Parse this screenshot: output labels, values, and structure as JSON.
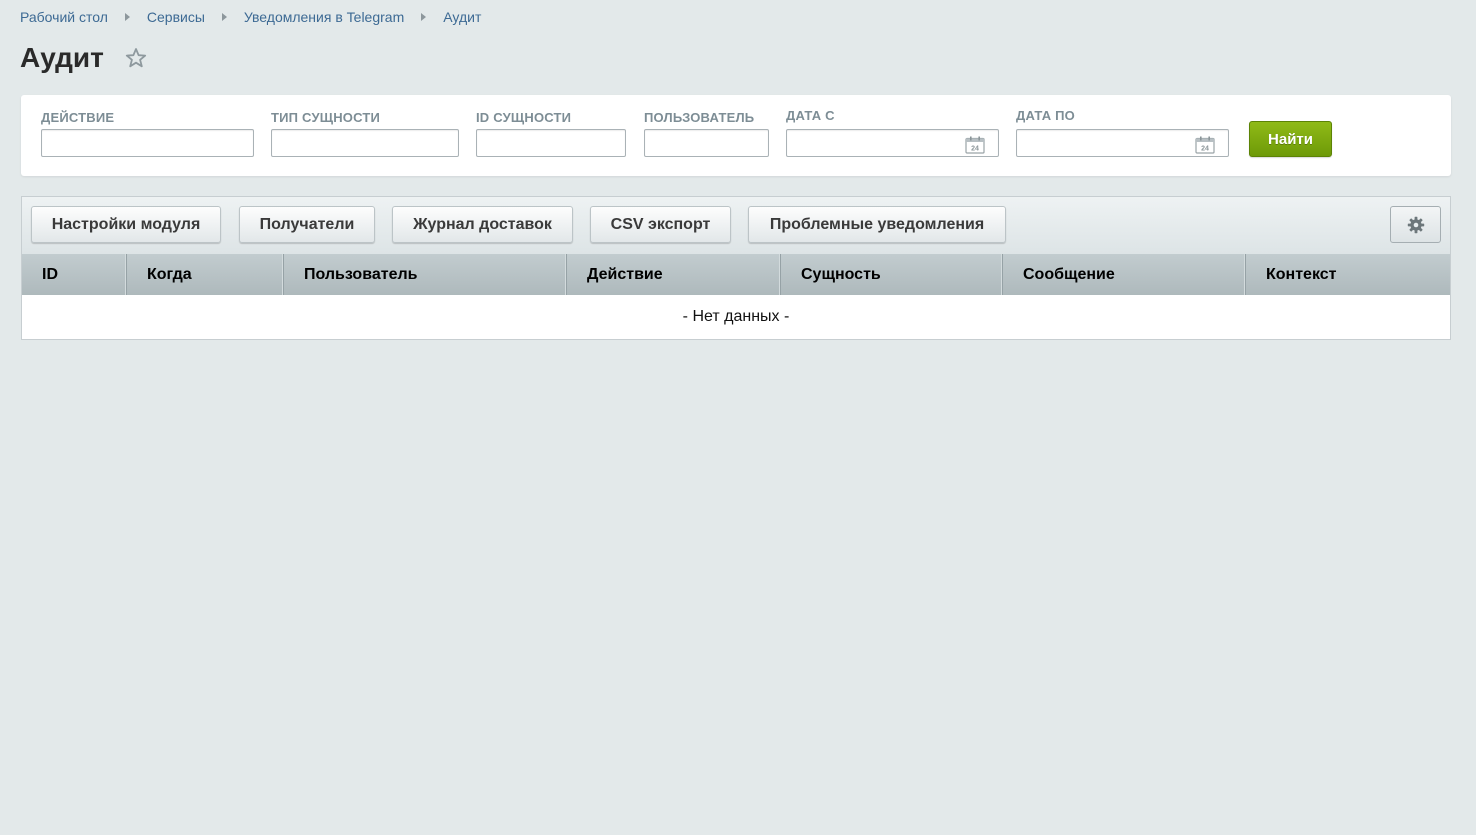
{
  "breadcrumb": [
    "Рабочий стол",
    "Сервисы",
    "Уведомления в Telegram",
    "Аудит"
  ],
  "page": {
    "title": "Аудит",
    "favorite_icon": "star-icon"
  },
  "filters": {
    "action": {
      "label": "ДЕЙСТВИЕ",
      "value": ""
    },
    "entity_type": {
      "label": "ТИП СУЩНОСТИ",
      "value": ""
    },
    "entity_id": {
      "label": "ID СУЩНОСТИ",
      "value": ""
    },
    "user": {
      "label": "ПОЛЬЗОВАТЕЛЬ",
      "value": ""
    },
    "date_from": {
      "label": "ДАТА С",
      "value": "",
      "icon": "calendar-icon",
      "icon_text": "24"
    },
    "date_to": {
      "label": "ДАТА ПО",
      "value": "",
      "icon": "calendar-icon",
      "icon_text": "24"
    },
    "find_label": "Найти"
  },
  "toolbar": {
    "buttons": [
      "Настройки модуля",
      "Получатели",
      "Журнал доставок",
      "CSV экспорт",
      "Проблемные уведомления"
    ],
    "settings_icon": "gear-icon"
  },
  "table": {
    "columns": [
      "ID",
      "Когда",
      "Пользователь",
      "Действие",
      "Сущность",
      "Сообщение",
      "Контекст"
    ],
    "empty_text": "- Нет данных -"
  },
  "colors": {
    "background": "#e3e9ea",
    "accent_green": "#7aa80f",
    "link": "#3d6a94",
    "header": "#b8c3c6"
  }
}
